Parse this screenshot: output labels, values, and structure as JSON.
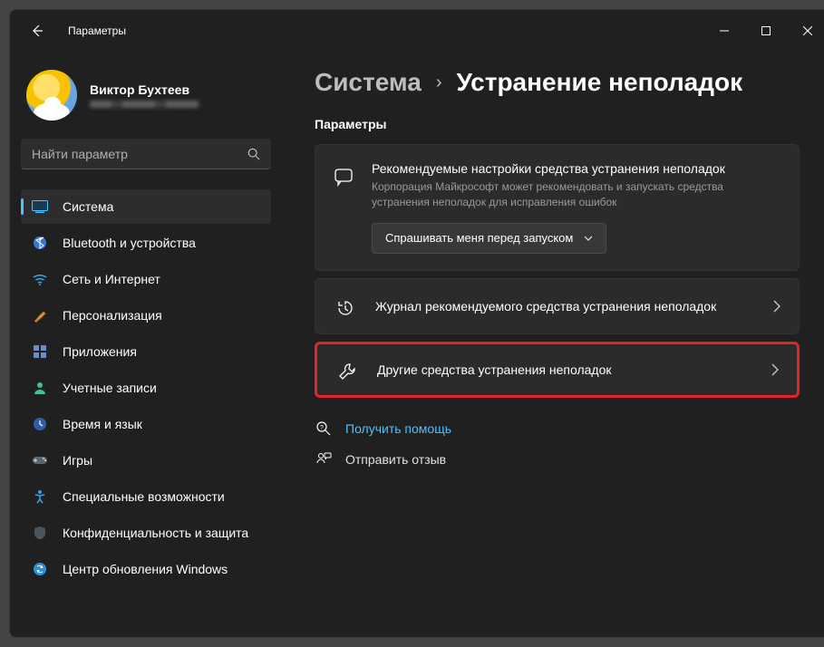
{
  "window": {
    "title": "Параметры"
  },
  "user": {
    "name": "Виктор Бухтеев"
  },
  "search": {
    "placeholder": "Найти параметр"
  },
  "sidebar": {
    "items": [
      {
        "label": "Система"
      },
      {
        "label": "Bluetooth и устройства"
      },
      {
        "label": "Сеть и Интернет"
      },
      {
        "label": "Персонализация"
      },
      {
        "label": "Приложения"
      },
      {
        "label": "Учетные записи"
      },
      {
        "label": "Время и язык"
      },
      {
        "label": "Игры"
      },
      {
        "label": "Специальные возможности"
      },
      {
        "label": "Конфиденциальность и защита"
      },
      {
        "label": "Центр обновления Windows"
      }
    ]
  },
  "breadcrumb": {
    "parent": "Система",
    "current": "Устранение неполадок"
  },
  "section": {
    "label": "Параметры"
  },
  "recommended": {
    "title": "Рекомендуемые настройки средства устранения неполадок",
    "desc": "Корпорация Майкрософт может рекомендовать и запускать средства устранения неполадок для исправления ошибок",
    "dropdown": "Спрашивать меня перед запуском"
  },
  "rows": {
    "history": "Журнал рекомендуемого средства устранения неполадок",
    "other": "Другие средства устранения неполадок"
  },
  "links": {
    "help": "Получить помощь",
    "feedback": "Отправить отзыв"
  }
}
